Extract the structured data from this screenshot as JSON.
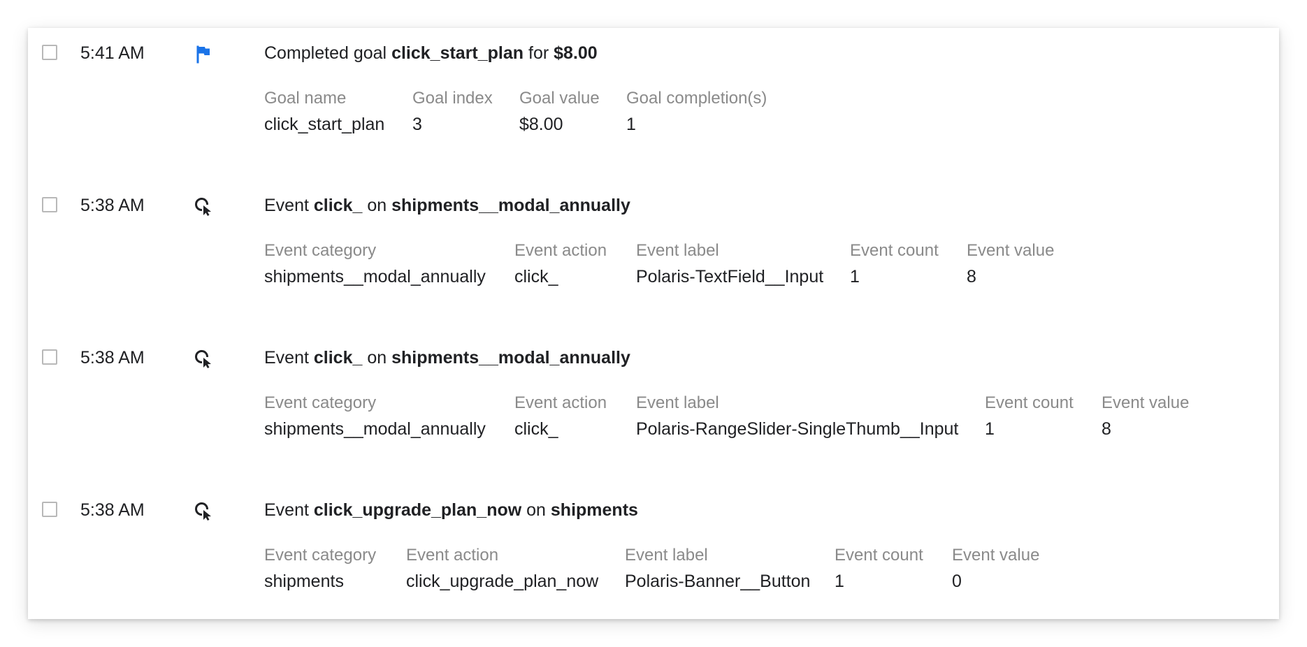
{
  "colors": {
    "flag_icon": "#1a73e8",
    "cursor_icon": "#202124",
    "label_text": "#8a8a8a",
    "value_text": "#202124",
    "checkbox_border": "#b8b8b8"
  },
  "entries": [
    {
      "time": "5:41 AM",
      "icon": "flag-icon",
      "headline": {
        "prefix": "Completed goal ",
        "name": "click_start_plan",
        "mid": " for ",
        "target": "$8.00"
      },
      "fields": [
        {
          "label": "Goal name",
          "value": "click_start_plan"
        },
        {
          "label": "Goal index",
          "value": "3"
        },
        {
          "label": "Goal value",
          "value": "$8.00"
        },
        {
          "label": "Goal completion(s)",
          "value": "1"
        }
      ]
    },
    {
      "time": "5:38 AM",
      "icon": "cursor-click-icon",
      "headline": {
        "prefix": "Event ",
        "name": "click_",
        "mid": " on ",
        "target": "shipments__modal_annually"
      },
      "fields": [
        {
          "label": "Event category",
          "value": "shipments__modal_annually"
        },
        {
          "label": "Event action",
          "value": "click_"
        },
        {
          "label": "Event label",
          "value": "Polaris-TextField__Input"
        },
        {
          "label": "Event count",
          "value": "1"
        },
        {
          "label": "Event value",
          "value": "8"
        }
      ]
    },
    {
      "time": "5:38 AM",
      "icon": "cursor-click-icon",
      "headline": {
        "prefix": "Event ",
        "name": "click_",
        "mid": " on ",
        "target": "shipments__modal_annually"
      },
      "fields": [
        {
          "label": "Event category",
          "value": "shipments__modal_annually"
        },
        {
          "label": "Event action",
          "value": "click_"
        },
        {
          "label": "Event label",
          "value": "Polaris-RangeSlider-SingleThumb__Input"
        },
        {
          "label": "Event count",
          "value": "1"
        },
        {
          "label": "Event value",
          "value": "8"
        }
      ]
    },
    {
      "time": "5:38 AM",
      "icon": "cursor-click-icon",
      "headline": {
        "prefix": "Event ",
        "name": "click_upgrade_plan_now",
        "mid": " on ",
        "target": "shipments"
      },
      "fields": [
        {
          "label": "Event category",
          "value": "shipments"
        },
        {
          "label": "Event action",
          "value": "click_upgrade_plan_now"
        },
        {
          "label": "Event label",
          "value": "Polaris-Banner__Button"
        },
        {
          "label": "Event count",
          "value": "1"
        },
        {
          "label": "Event value",
          "value": "0"
        }
      ]
    }
  ]
}
